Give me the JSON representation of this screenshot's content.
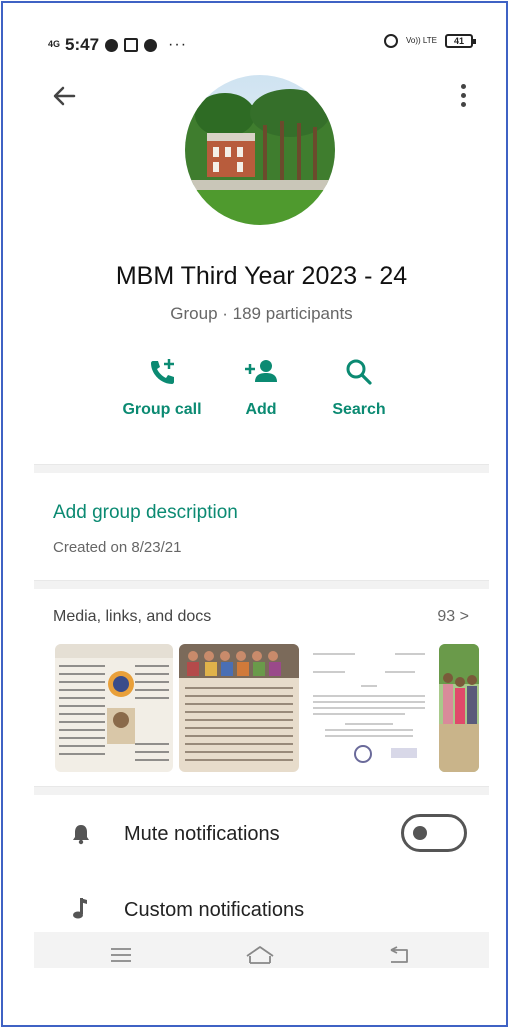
{
  "status_bar": {
    "network": "4G",
    "time": "5:47",
    "more": "···",
    "volte": "Vo)) LTE",
    "battery": "41"
  },
  "group": {
    "name": "MBM Third Year 2023 - 24",
    "subtitle": "Group · 189 participants"
  },
  "actions": [
    {
      "label": "Group call",
      "icon": "add-call-icon"
    },
    {
      "label": "Add",
      "icon": "add-person-icon"
    },
    {
      "label": "Search",
      "icon": "search-icon"
    }
  ],
  "description": {
    "add_label": "Add group description",
    "created": "Created on 8/23/21"
  },
  "media": {
    "title": "Media, links, and docs",
    "count": "93 >"
  },
  "settings": [
    {
      "label": "Mute notifications",
      "icon": "bell-icon",
      "toggle": false
    },
    {
      "label": "Custom notifications",
      "icon": "music-note-icon"
    }
  ],
  "colors": {
    "accent": "#0b8a72",
    "frame": "#3f62c4"
  }
}
